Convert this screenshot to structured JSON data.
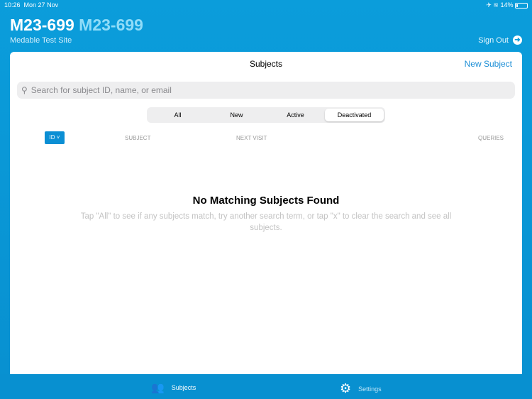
{
  "status": {
    "time": "10:26",
    "date": "Mon 27 Nov",
    "battery": "14%"
  },
  "header": {
    "title": "M23-699",
    "subtitle": "M23-699",
    "site": "Medable Test Site",
    "sign_out": "Sign Out"
  },
  "card": {
    "title": "Subjects",
    "new_subject": "New Subject",
    "search_placeholder": "Search for subject ID, name, or email",
    "segments": [
      "All",
      "New",
      "Active",
      "Deactivated"
    ],
    "selected_segment": "Deactivated",
    "sort_button": "ID",
    "columns": [
      "SUBJECT",
      "NEXT VISIT",
      "QUERIES"
    ],
    "empty_title": "No Matching Subjects Found",
    "empty_message": "Tap \"All\" to see if any subjects match, try another search term, or tap \"x\" to clear the search and see all subjects."
  },
  "tabs": [
    {
      "label": "Subjects",
      "icon": "people-icon"
    },
    {
      "label": "Settings",
      "icon": "gear-icon"
    }
  ]
}
